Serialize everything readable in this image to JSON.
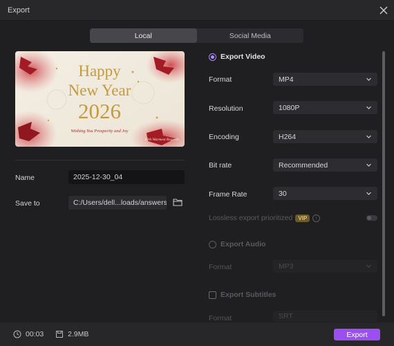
{
  "window": {
    "title": "Export"
  },
  "tabs": [
    {
      "label": "Local",
      "active": true
    },
    {
      "label": "Social Media",
      "active": false
    }
  ],
  "preview": {
    "line1": "Happy",
    "line2": "New Year",
    "line3": "2026",
    "subtitle": "Wishing You Prosperity and Joy",
    "signature": "With Warmest Regards"
  },
  "left": {
    "name_label": "Name",
    "name_value": "2025-12-30_04",
    "save_label": "Save to",
    "save_value": "C:/Users/dell...loads/answers"
  },
  "export_video": {
    "title": "Export Video",
    "selected": true,
    "rows": [
      {
        "label": "Format",
        "value": "MP4"
      },
      {
        "label": "Resolution",
        "value": "1080P"
      },
      {
        "label": "Encoding",
        "value": "H264"
      },
      {
        "label": "Bit rate",
        "value": "Recommended"
      },
      {
        "label": "Frame Rate",
        "value": "30"
      }
    ],
    "lossless_label": "Lossless export prioritized",
    "vip_badge": "VIP"
  },
  "export_audio": {
    "title": "Export Audio",
    "format_label": "Format",
    "format_value": "MP3"
  },
  "export_subtitles": {
    "title": "Export Subtitles",
    "format_label": "Format",
    "format_value": "SRT"
  },
  "footer": {
    "duration": "00:03",
    "size": "2.9MB",
    "export_label": "Export"
  },
  "colors": {
    "accent": "#9b4ff0",
    "background": "#1f1f22",
    "gold": "#c9a44a",
    "poinsettia": "#b3202a"
  }
}
